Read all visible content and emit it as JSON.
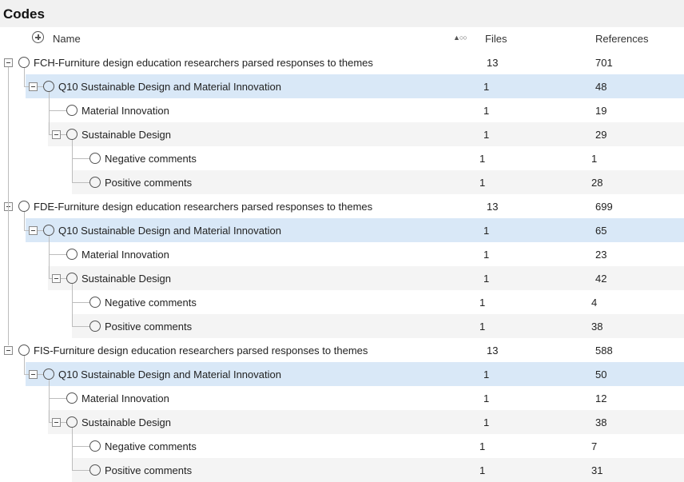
{
  "panel": {
    "title": "Codes"
  },
  "columns": {
    "name": "Name",
    "files": "Files",
    "references": "References",
    "sort_icon": "sort-icon"
  },
  "rows": [
    {
      "label": "FCH-Furniture design education researchers parsed responses to themes",
      "files": "13",
      "refs": "701",
      "level": 0,
      "expandable": true,
      "highlight": false
    },
    {
      "label": "Q10 Sustainable Design and Material Innovation",
      "files": "1",
      "refs": "48",
      "level": 1,
      "expandable": true,
      "highlight": true
    },
    {
      "label": "Material Innovation",
      "files": "1",
      "refs": "19",
      "level": 2,
      "expandable": false,
      "highlight": false
    },
    {
      "label": "Sustainable Design",
      "files": "1",
      "refs": "29",
      "level": 2,
      "expandable": true,
      "highlight": false
    },
    {
      "label": "Negative comments",
      "files": "1",
      "refs": "1",
      "level": 3,
      "expandable": false,
      "highlight": false
    },
    {
      "label": "Positive comments",
      "files": "1",
      "refs": "28",
      "level": 3,
      "expandable": false,
      "highlight": false
    },
    {
      "label": "FDE-Furniture design education researchers parsed responses to themes",
      "files": "13",
      "refs": "699",
      "level": 0,
      "expandable": true,
      "highlight": false
    },
    {
      "label": "Q10 Sustainable Design and Material Innovation",
      "files": "1",
      "refs": "65",
      "level": 1,
      "expandable": true,
      "highlight": true
    },
    {
      "label": "Material Innovation",
      "files": "1",
      "refs": "23",
      "level": 2,
      "expandable": false,
      "highlight": false
    },
    {
      "label": "Sustainable Design",
      "files": "1",
      "refs": "42",
      "level": 2,
      "expandable": true,
      "highlight": false
    },
    {
      "label": "Negative comments",
      "files": "1",
      "refs": "4",
      "level": 3,
      "expandable": false,
      "highlight": false
    },
    {
      "label": "Positive comments",
      "files": "1",
      "refs": "38",
      "level": 3,
      "expandable": false,
      "highlight": false
    },
    {
      "label": "FIS-Furniture design education researchers parsed responses to themes",
      "files": "13",
      "refs": "588",
      "level": 0,
      "expandable": true,
      "highlight": false
    },
    {
      "label": "Q10 Sustainable Design and Material Innovation",
      "files": "1",
      "refs": "50",
      "level": 1,
      "expandable": true,
      "highlight": true
    },
    {
      "label": "Material Innovation",
      "files": "1",
      "refs": "12",
      "level": 2,
      "expandable": false,
      "highlight": false
    },
    {
      "label": "Sustainable Design",
      "files": "1",
      "refs": "38",
      "level": 2,
      "expandable": true,
      "highlight": false
    },
    {
      "label": "Negative comments",
      "files": "1",
      "refs": "7",
      "level": 3,
      "expandable": false,
      "highlight": false
    },
    {
      "label": "Positive comments",
      "files": "1",
      "refs": "31",
      "level": 3,
      "expandable": false,
      "highlight": false
    }
  ],
  "colors": {
    "selected_row": "#d9e8f7",
    "alt_row": "#f4f4f4",
    "header_bg": "#f1f1f1"
  }
}
